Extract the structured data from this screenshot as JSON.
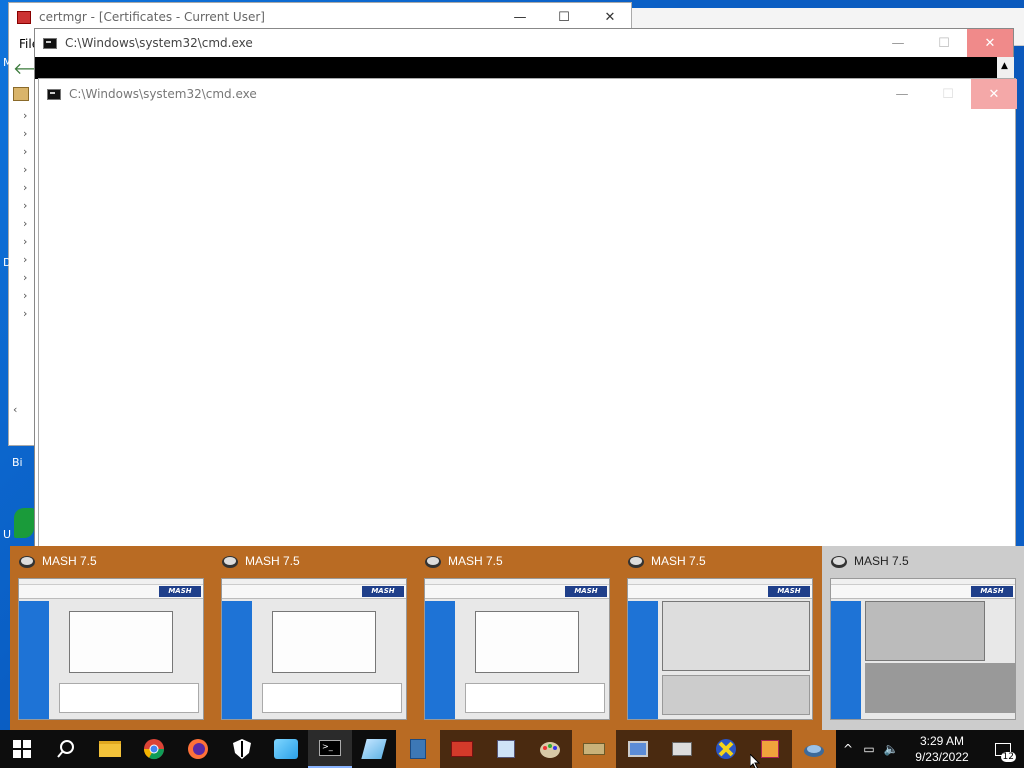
{
  "certmgr": {
    "title": "certmgr - [Certificates - Current User]",
    "menu_first": "File",
    "side_labels": [
      "M",
      "D",
      "Bi",
      "U"
    ]
  },
  "cmd_back": {
    "title": "C:\\Windows\\system32\\cmd.exe"
  },
  "cmd_front": {
    "title": "C:\\Windows\\system32\\cmd.exe"
  },
  "thumbnails": [
    {
      "title": "MASH 7.5"
    },
    {
      "title": "MASH 7.5"
    },
    {
      "title": "MASH 7.5"
    },
    {
      "title": "MASH 7.5"
    },
    {
      "title": "MASH 7.5"
    }
  ],
  "taskbar": {
    "icons": [
      "windows-start-icon",
      "search-icon",
      "file-explorer-icon",
      "chrome-icon",
      "firefox-icon",
      "security-shield-icon",
      "photo-app-icon",
      "cmd-icon",
      "edit-app-icon",
      "calculator-icon",
      "toolbox-icon",
      "3d-app-icon",
      "paint-icon",
      "scanner-icon",
      "computer-app-icon",
      "network-app-icon",
      "x-app-icon",
      "media-player-icon",
      "mash-icon"
    ],
    "time": "3:29 AM",
    "date": "9/23/2022",
    "notification_count": "12"
  },
  "colors": {
    "thumb_bg": "#b96b23",
    "desktop": "#0a60c8",
    "taskbar": "#0d0d0d"
  }
}
